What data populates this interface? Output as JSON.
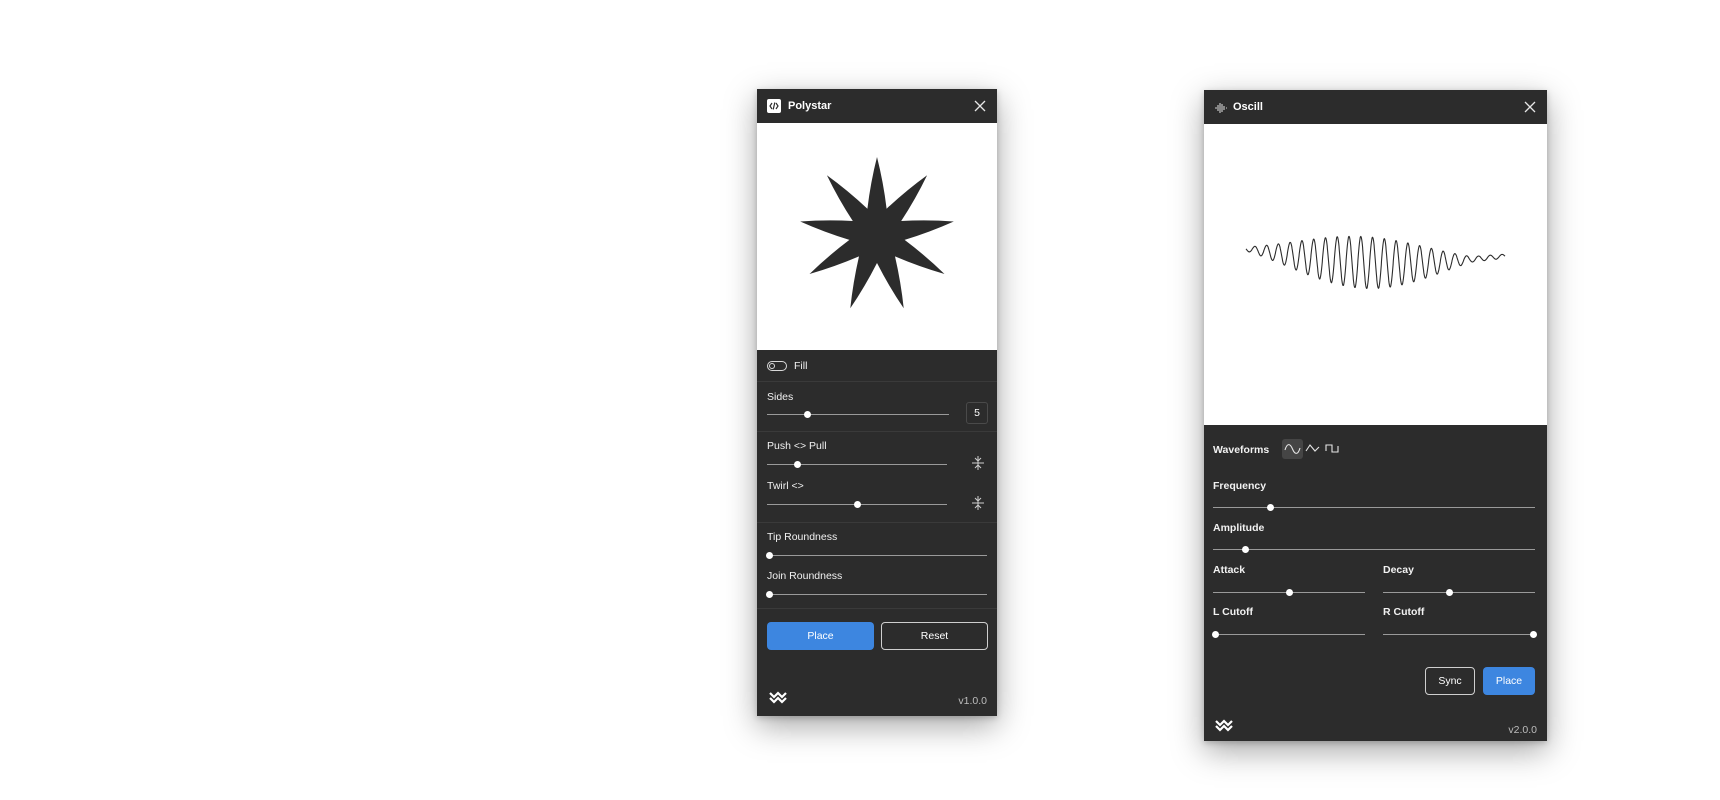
{
  "polystar": {
    "title": "Polystar",
    "fill_label": "Fill",
    "sides": {
      "label": "Sides",
      "value": "5",
      "level": 0.22
    },
    "push_pull": {
      "label": "Push <> Pull",
      "level": 0.17
    },
    "twirl": {
      "label": "Twirl <>",
      "level": 0.5
    },
    "tip_roundness": {
      "label": "Tip Roundness",
      "level": 0.0
    },
    "join_roundness": {
      "label": "Join Roundness",
      "level": 0.0
    },
    "place_label": "Place",
    "reset_label": "Reset",
    "version": "v1.0.0"
  },
  "oscill": {
    "title": "Oscill",
    "waveforms_label": "Waveforms",
    "waveforms": [
      "sine-wave-icon",
      "triangle-wave-icon",
      "square-wave-icon"
    ],
    "selected_waveform": 0,
    "frequency": {
      "label": "Frequency",
      "level": 0.18
    },
    "amplitude": {
      "label": "Amplitude",
      "level": 0.1
    },
    "attack": {
      "label": "Attack",
      "level": 0.5
    },
    "decay": {
      "label": "Decay",
      "level": 0.44
    },
    "l_cutoff": {
      "label": "L Cutoff",
      "level": 0.0
    },
    "r_cutoff": {
      "label": "R Cutoff",
      "level": 1.0
    },
    "sync_label": "Sync",
    "place_label": "Place",
    "version": "v2.0.0"
  },
  "colors": {
    "panel": "#2c2c2c",
    "accent": "#3d86e0",
    "preview": "#ffffff"
  }
}
